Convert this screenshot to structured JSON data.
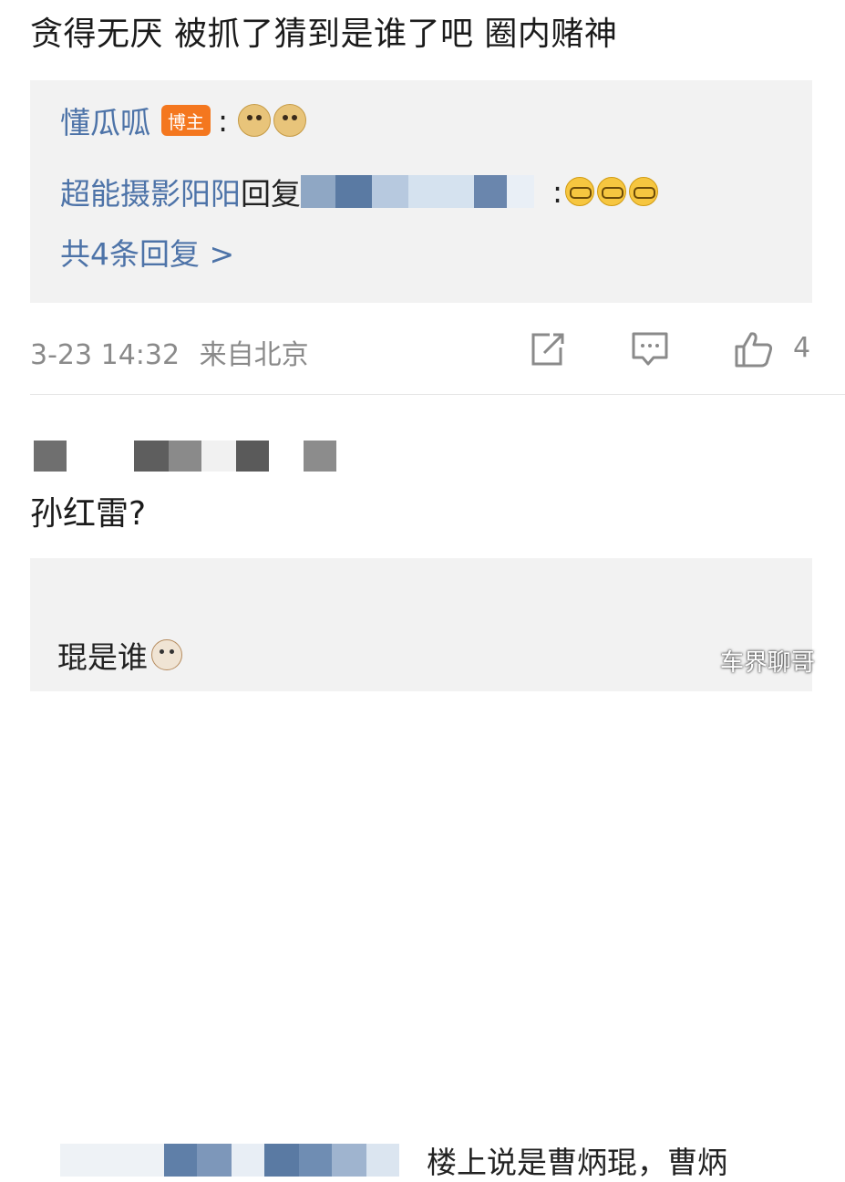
{
  "post": {
    "text": "贪得无厌 被抓了猜到是谁了吧 圈内赌神"
  },
  "reply_preview": {
    "line1": {
      "user": "懂瓜呱",
      "badge": "博主",
      "colon": ":"
    },
    "line2": {
      "user": "超能摄影阳阳",
      "action": "回复",
      "tail": ":"
    },
    "more_link": "共4条回复 >"
  },
  "meta": {
    "timestamp": "3-23 14:32",
    "location": "来自北京",
    "like_count": "4"
  },
  "comment2": {
    "text": "孙红雷?"
  },
  "reply2": {
    "line1_text": "楼上说是曹炳琨，曹炳",
    "line2_text": "琨是谁"
  },
  "watermark": "车界聊哥",
  "colors": {
    "link_blue": "#4d73a8",
    "badge_orange": "#f4771f",
    "meta_gray": "#8a8a8a",
    "panel_bg": "#f2f2f2"
  }
}
